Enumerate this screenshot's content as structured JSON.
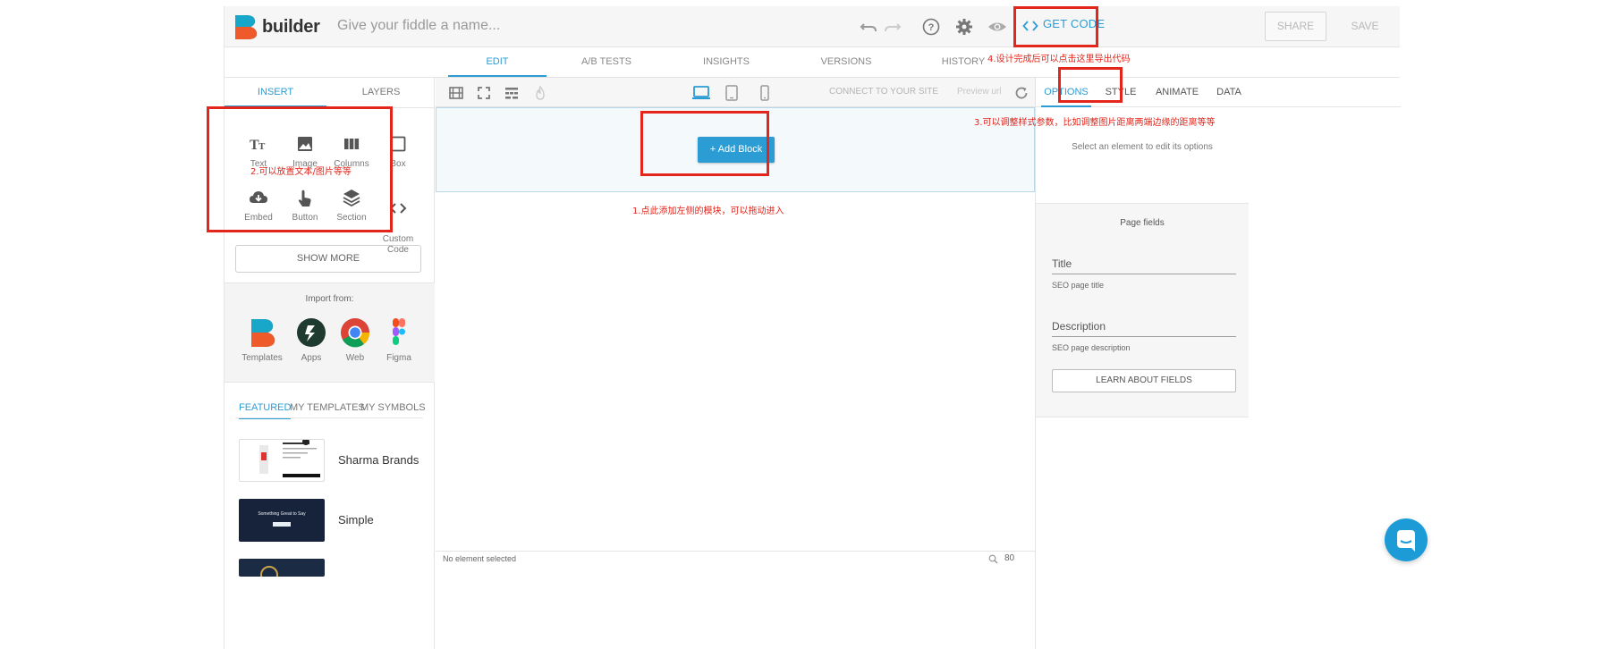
{
  "app": {
    "logo_text": "builder",
    "fiddle_placeholder": "Give your fiddle a name...",
    "accent_color": "#2b9cd4",
    "annotation_color": "#e3251b"
  },
  "topbar": {
    "get_code_label": "GET CODE",
    "share_label": "SHARE",
    "save_label": "SAVE",
    "icons": [
      "undo-icon",
      "redo-icon",
      "help-icon",
      "gear-icon",
      "eye-icon",
      "code-icon"
    ]
  },
  "main_tabs": [
    {
      "label": "EDIT",
      "active": true
    },
    {
      "label": "A/B TESTS",
      "active": false
    },
    {
      "label": "INSIGHTS",
      "active": false
    },
    {
      "label": "VERSIONS",
      "active": false
    },
    {
      "label": "HISTORY",
      "active": false
    }
  ],
  "left_panel": {
    "tabs": [
      {
        "label": "INSERT",
        "active": true
      },
      {
        "label": "LAYERS",
        "active": false
      }
    ],
    "insert_items": [
      {
        "label": "Text",
        "icon": "text-icon"
      },
      {
        "label": "Image",
        "icon": "image-icon"
      },
      {
        "label": "Columns",
        "icon": "columns-icon"
      },
      {
        "label": "Box",
        "icon": "box-icon"
      },
      {
        "label": "Embed",
        "icon": "cloud-download-icon"
      },
      {
        "label": "Button",
        "icon": "pointer-hand-icon"
      },
      {
        "label": "Section",
        "icon": "layers-icon"
      },
      {
        "label": "Custom\nCode",
        "icon": "code-icon"
      }
    ],
    "show_more_label": "SHOW MORE",
    "import_label": "Import from:",
    "import_items": [
      {
        "label": "Templates",
        "icon": "builder-logo-icon"
      },
      {
        "label": "Apps",
        "icon": "apps-icon"
      },
      {
        "label": "Web",
        "icon": "chrome-icon"
      },
      {
        "label": "Figma",
        "icon": "figma-icon"
      }
    ],
    "template_tabs": [
      {
        "label": "FEATURED",
        "active": true
      },
      {
        "label": "MY TEMPLATES",
        "active": false
      },
      {
        "label": "MY SYMBOLS",
        "active": false
      }
    ],
    "templates": [
      {
        "name": "Sharma Brands"
      },
      {
        "name": "Simple",
        "thumb_text": "Something Great to Say"
      },
      {
        "name": ""
      }
    ]
  },
  "center": {
    "toolbar_icons": [
      "film-icon",
      "fullscreen-icon",
      "grid-icon",
      "fire-icon",
      "desktop-icon",
      "tablet-icon",
      "mobile-icon",
      "refresh-icon"
    ],
    "connect_label": "CONNECT TO YOUR SITE",
    "preview_label": "Preview url",
    "add_block_label": "+ Add Block",
    "status_text": "No element selected",
    "zoom_value": "80"
  },
  "right_panel": {
    "tabs": [
      {
        "label": "OPTIONS",
        "active": true
      },
      {
        "label": "STYLE",
        "active": false
      },
      {
        "label": "ANIMATE",
        "active": false
      },
      {
        "label": "DATA",
        "active": false
      }
    ],
    "select_hint": "Select an element to edit its options",
    "page_fields_title": "Page fields",
    "title_label": "Title",
    "title_help": "SEO page title",
    "description_label": "Description",
    "description_help": "SEO page description",
    "learn_label": "LEARN ABOUT FIELDS"
  },
  "annotations": {
    "a1": "1.点此添加左侧的模块，可以拖动进入",
    "a2": "2.可以放置文本/图片等等",
    "a3": "3.可以调整样式参数，比如调整图片距离两端边缘的距离等等",
    "a4": "4.设计完成后可以点击这里导出代码"
  }
}
